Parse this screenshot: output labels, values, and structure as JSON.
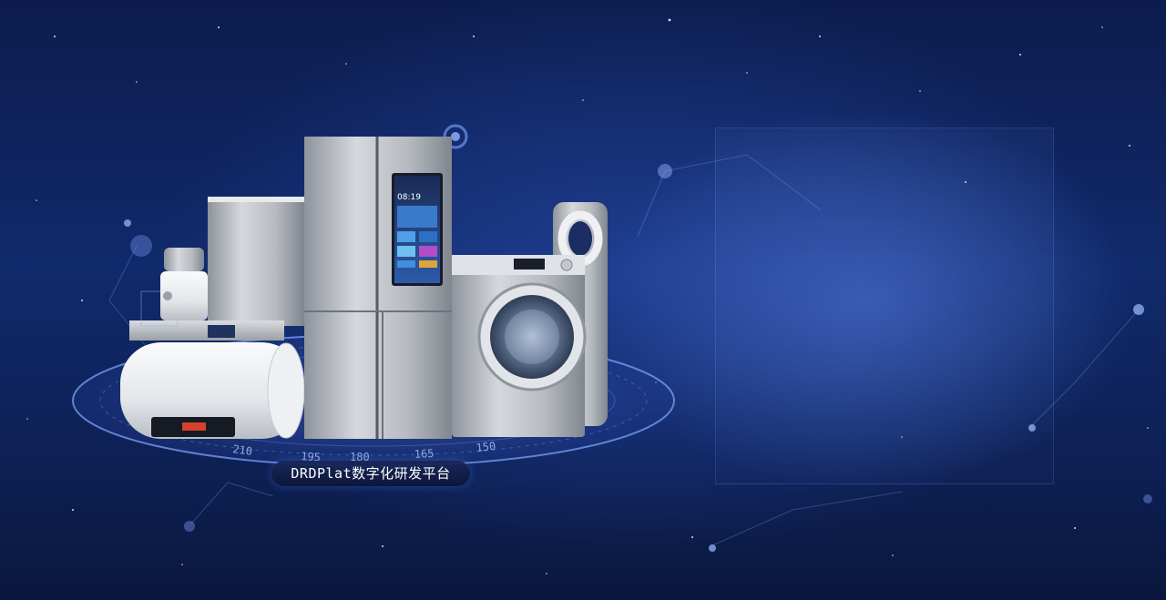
{
  "banner": {
    "caption": "DRDPlat数字化研发平台",
    "dial_ticks": [
      "210",
      "195",
      "180",
      "165",
      "150"
    ],
    "fridge_time": "08:19"
  },
  "colors": {
    "background": "#0c1c4d",
    "accent": "#5a8cff",
    "appliance_silver": "#c9ccd1"
  },
  "icons": {
    "products": [
      "refrigerator-icon",
      "washing-machine-icon",
      "water-heater-icon",
      "range-hood-icon",
      "air-purifier-icon",
      "food-processor-icon"
    ]
  }
}
